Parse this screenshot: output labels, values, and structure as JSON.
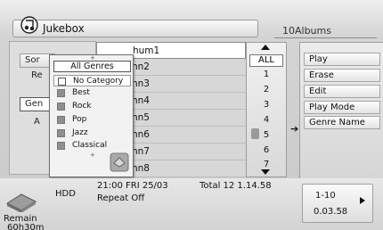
{
  "header": {
    "title": "Jukebox",
    "album_count": "10Albums"
  },
  "left_panel": {
    "sort_label": "Sor",
    "re_label": "Re",
    "gen_label": "Gen",
    "a_label": "A"
  },
  "album_list": [
    {
      "label": "hum1"
    },
    {
      "label": "hn2"
    },
    {
      "label": "hn3"
    },
    {
      "label": "hn4"
    },
    {
      "label": "hn5"
    },
    {
      "label": "hn6"
    },
    {
      "label": "hn7"
    },
    {
      "label": "hn8"
    }
  ],
  "number_column": {
    "all_label": "ALL",
    "numbers": [
      "1",
      "2",
      "3",
      "4",
      "5",
      "6",
      "7"
    ]
  },
  "right_menu": {
    "items": [
      "Play",
      "Erase",
      "Edit",
      "Play Mode",
      "Genre Name"
    ]
  },
  "genre_popup": {
    "header": "All Genres",
    "items": [
      {
        "label": "No Category",
        "swatch": "empty"
      },
      {
        "label": "Best",
        "swatch": "gray"
      },
      {
        "label": "Rock",
        "swatch": "gray"
      },
      {
        "label": "Pop",
        "swatch": "gray"
      },
      {
        "label": "Jazz",
        "swatch": "gray"
      },
      {
        "label": "Classical",
        "swatch": "gray"
      }
    ]
  },
  "footer": {
    "hdd": "HDD",
    "remain_label": "Remain",
    "remain_value": "60h30m",
    "date": "21:00  FRI  25/03",
    "repeat": "Repeat Off",
    "total": "Total 12  1.14.58",
    "page_range": "1-10",
    "page_time": "0.03.58"
  }
}
